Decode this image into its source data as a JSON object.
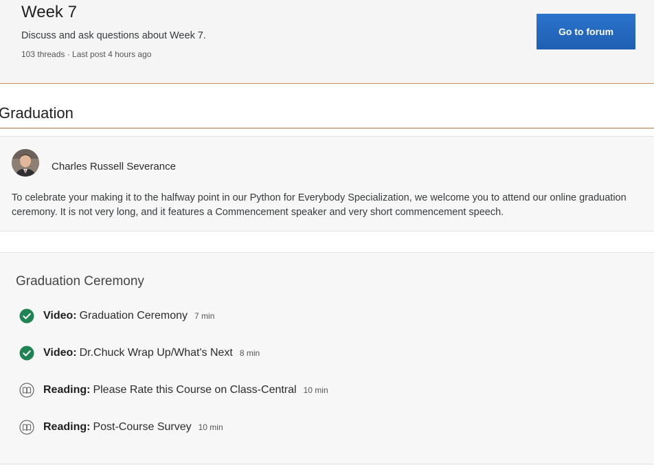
{
  "forum": {
    "title": "Week 7",
    "description": "Discuss and ask questions about Week 7.",
    "meta": "103 threads · Last post 4 hours ago",
    "button_label": "Go to forum"
  },
  "section": {
    "title": "Graduation"
  },
  "message": {
    "author": "Charles Russell Severance",
    "body": "To celebrate your making it to the halfway point in our Python for Everybody Specialization, we welcome you to attend our online graduation ceremony. It is not very long, and it features a Commencement speaker and very short commencement speech."
  },
  "lesson": {
    "title": "Graduation Ceremony",
    "items": [
      {
        "type": "Video:",
        "name": "Graduation Ceremony",
        "duration": "7 min",
        "icon": "check-circle-icon",
        "completed": true
      },
      {
        "type": "Video:",
        "name": "Dr.Chuck Wrap Up/What's Next",
        "duration": "8 min",
        "icon": "check-circle-icon",
        "completed": true
      },
      {
        "type": "Reading:",
        "name": "Please Rate this Course on Class-Central",
        "duration": "10 min",
        "icon": "book-icon",
        "completed": false
      },
      {
        "type": "Reading:",
        "name": "Post-Course Survey",
        "duration": "10 min",
        "icon": "book-icon",
        "completed": false
      }
    ]
  },
  "colors": {
    "accent": "#1f5fb3",
    "check_green": "#1f8354",
    "divider": "#c88a5a"
  }
}
